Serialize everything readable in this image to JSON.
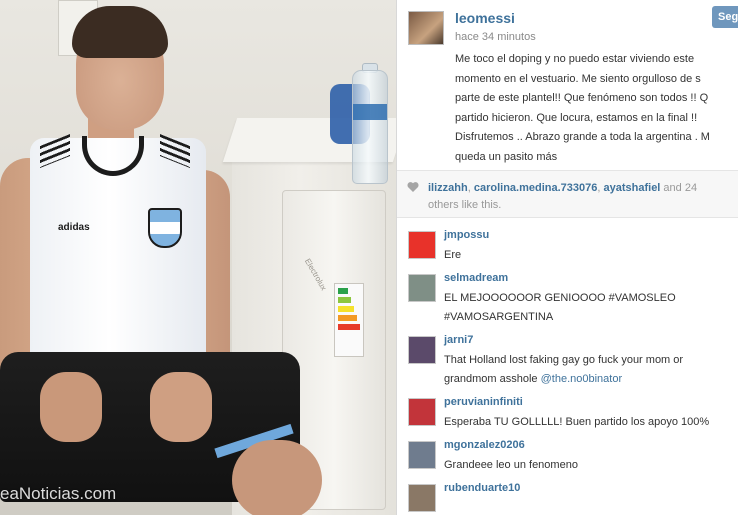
{
  "photo": {
    "watermark": "eaNoticias.com",
    "shirt_brand": "adidas",
    "fridge_brand": "Electrolux"
  },
  "post": {
    "username": "leomessi",
    "time": "hace 34 minutos",
    "follow_label": "Seg",
    "caption_lines": [
      "Me toco el doping y no puedo estar viviendo este",
      "momento en el vestuario. Me siento orgulloso de s",
      "parte de este plantel!! Que fenómeno son todos !! Q",
      "partido hicieron. Que locura, estamos en la final !!",
      "Disfrutemos .. Abrazo grande a toda la argentina . M",
      "queda un pasito más"
    ]
  },
  "likes": {
    "user1": "ilizzahh",
    "sep1": ", ",
    "user2": "carolina.medina.733076",
    "sep2": ", ",
    "user3": "ayatshafiel",
    "tail": " and 24",
    "line2": "others like this."
  },
  "comments": [
    {
      "user": "jmpossu",
      "lines": [
        "Ere"
      ],
      "avatar_color": "#e8322a"
    },
    {
      "user": "selmadream",
      "lines": [
        "EL MEJOOOOOOR GENIOOOO #VAMOSLEO",
        "#VAMOSARGENTINA"
      ],
      "avatar_color": "#7f8f86"
    },
    {
      "user": "jarni7",
      "lines": [
        "That Holland lost faking gay go fuck your mom or"
      ],
      "line2_prefix": "grandmom asshole ",
      "line2_mention": "@the.no0binator",
      "avatar_color": "#5b4a6a"
    },
    {
      "user": "peruvianinfiniti",
      "lines": [
        "Esperaba TU GOLLLLL! Buen partido los apoyo 100%"
      ],
      "avatar_color": "#c2343a"
    },
    {
      "user": "mgonzalez0206",
      "lines": [
        "Grandeee leo un fenomeno"
      ],
      "avatar_color": "#6f7c8e"
    },
    {
      "user": "rubenduarte10",
      "lines": [
        ""
      ],
      "avatar_color": "#8a7866"
    }
  ],
  "colors": {
    "link_blue": "#3f729b",
    "follow_button": "#6f97bd",
    "likes_bg": "#f7f7f7"
  }
}
